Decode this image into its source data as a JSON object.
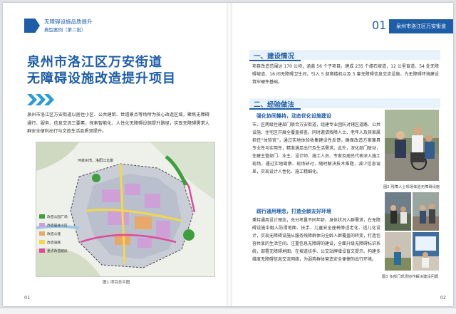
{
  "header_left": {
    "line1": "无障碍设施品质提升",
    "line2": "典型案例（第二批）"
  },
  "title": {
    "line1": "泉州市洛江区万安街道",
    "line2": "无障碍设施改造提升项目"
  },
  "intro": "泉州市洛江区万安街道以居住小区、公共建筑、世遗景点等场所为核心改造区域，聚焦无障碍通行、服务、信息交流三要素，探索智能化、人性化无障碍设施提升路径，实现无障碍需求人群安全便利出行与文旅生活品质双提升。",
  "map": {
    "caption": "图1 项目总平图",
    "label_river": "环泉州湾，洛阳江北岸",
    "legend": [
      {
        "label": "改造公园广场",
        "color": "#3d9e3d"
      },
      {
        "label": "改造居住小区",
        "color": "#cfa0d8"
      },
      {
        "label": "改造公建",
        "color": "#e8a86a"
      },
      {
        "label": "改造道路",
        "color": "#f2d84a"
      },
      {
        "label": "重点改造路段",
        "color": "#e04a9a"
      }
    ]
  },
  "page_left_number": "01",
  "header_right": {
    "number": "01",
    "label": "泉州市洛江区万安街道"
  },
  "section1": {
    "heading": "一、建设情况",
    "body": "项目改造范围达 170 公顷，涵盖 56 个子项目。建成 235 个缘石坡道，12 公里盲道、54 处无障碍坡道、16 间无障碍卫生间，引入 5 部爬楼机以及 5 套无障碍信息交流设施，为无障碍环境建设筑牢硬件基础。"
  },
  "section2": {
    "heading": "二、经验做法",
    "sub1": "强化协同搡持，动态优化设施建设",
    "body1": "市、区两级住建部门联合万安街道，组建专业团队对辖区道路、公共设施、住宅区开展全覆盖排查。同时邀请残障人士、老年人及其家属担任“体验官”，通过实地体验收集建设性反馈，确保改造方案兼具专业性与实用性，精准满足出行及生活需求。此外，深化部门联动，住建主管部门、业主、设计师、施工人员、专家及居民代表深入施工现场，通过实地勘察、现场研讨，随时解决技术难题，减少信息误差，实现设计人性化、施工精细化。",
    "sub2": "践行通用理念，打造全龄友好环境",
    "body2": "秉持通用设计理念，充分考量不同年龄、身体状况人群需求，在无障碍设施中融入防滑地面、扶手、儿童安全座椅等适老化、适儿化设计，实现无障碍设施从服务残障群体向全龄人群覆盖的转变，打造包容共享的生活空间。注重信息无障碍的建设，全面升级无障碍标识系统，部署无障碍地图，在坡道扶手、公交站牌增设盲文提示。构建多维度无障碍信息交流网络，为弱势群体营造安全便捷的出行环境。"
  },
  "captions": {
    "fig2": "图2 残障人士现场体验无障碍设施",
    "fig3": "图3 多部门现场协作解决建设问题"
  },
  "page_right_number": "02"
}
